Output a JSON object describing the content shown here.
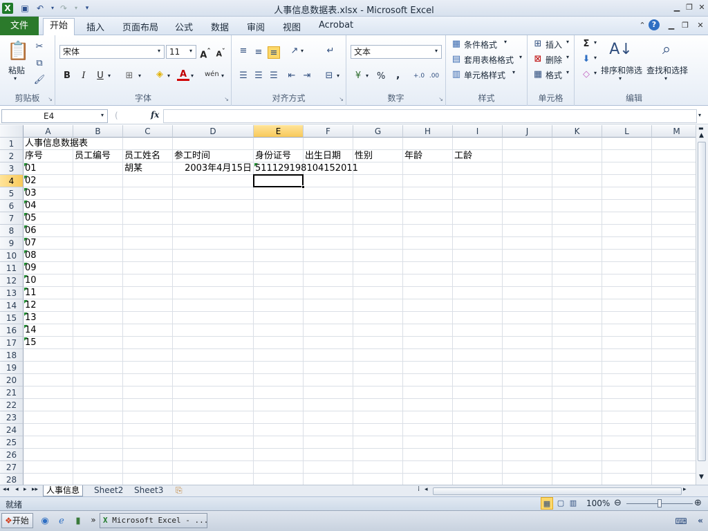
{
  "window": {
    "title": "人事信息数据表.xlsx - Microsoft Excel"
  },
  "menu": {
    "file": "文件",
    "tabs": [
      "开始",
      "插入",
      "页面布局",
      "公式",
      "数据",
      "审阅",
      "视图",
      "Acrobat"
    ]
  },
  "ribbon": {
    "clipboard": {
      "label": "剪贴板",
      "paste": "粘贴"
    },
    "font": {
      "label": "字体",
      "name": "宋体",
      "size": "11"
    },
    "alignment": {
      "label": "对齐方式"
    },
    "number": {
      "label": "数字",
      "format": "文本",
      "percent": "%",
      "comma": ","
    },
    "styles": {
      "label": "样式",
      "conditional": "条件格式",
      "table": "套用表格格式",
      "cell": "单元格样式"
    },
    "cells": {
      "label": "单元格",
      "insert": "插入",
      "delete": "删除",
      "format": "格式"
    },
    "editing": {
      "label": "编辑",
      "sort": "排序和筛选",
      "find": "查找和选择"
    }
  },
  "formula": {
    "namebox": "E4",
    "fx": "fx",
    "content": ""
  },
  "grid": {
    "columns": [
      "A",
      "B",
      "C",
      "D",
      "E",
      "F",
      "G",
      "H",
      "I",
      "J",
      "K",
      "L",
      "M"
    ],
    "selected_col": "E",
    "selected_row": 4,
    "rows": [
      "1",
      "2",
      "3",
      "4",
      "5",
      "6",
      "7",
      "8",
      "9",
      "10",
      "11",
      "12",
      "13",
      "14",
      "15",
      "16",
      "17",
      "18",
      "19",
      "20",
      "21",
      "22",
      "23",
      "24",
      "25",
      "26",
      "27",
      "28"
    ],
    "cells": {
      "A1": "人事信息数据表",
      "A2": "序号",
      "B2": "员工编号",
      "C2": "员工姓名",
      "D2": "参工时间",
      "E2": "身份证号",
      "F2": "出生日期",
      "G2": "性别",
      "H2": "年龄",
      "I2": "工龄",
      "A3": "01",
      "C3": "胡某",
      "D3": "2003年4月15日",
      "E3": "511129198104152011",
      "A4": "02",
      "A5": "03",
      "A6": "04",
      "A7": "05",
      "A8": "06",
      "A9": "07",
      "A10": "08",
      "A11": "09",
      "A12": "10",
      "A13": "11",
      "A14": "12",
      "A15": "13",
      "A16": "14",
      "A17": "15"
    }
  },
  "sheets": {
    "tabs": [
      "人事信息",
      "Sheet2",
      "Sheet3"
    ],
    "active": "人事信息"
  },
  "status": {
    "ready": "就绪",
    "zoom": "100%"
  },
  "taskbar": {
    "start": "开始",
    "app": "Microsoft Excel - ..."
  }
}
